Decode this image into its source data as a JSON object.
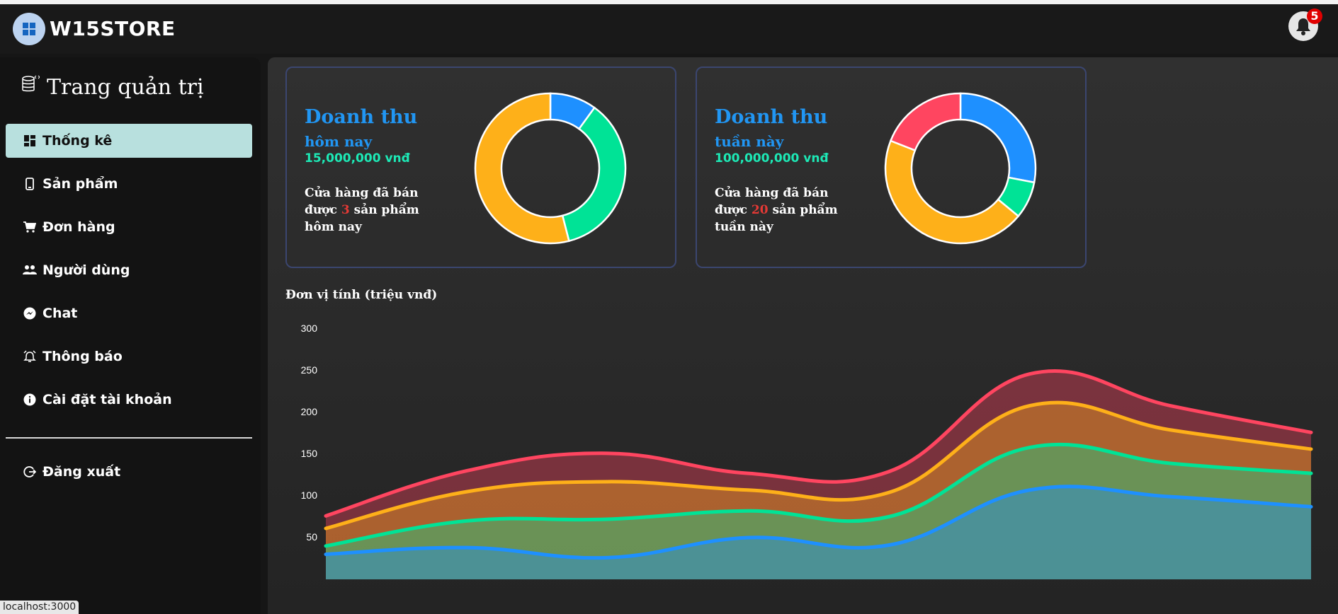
{
  "app": {
    "brand": "W15STORE",
    "notification_count": "5"
  },
  "sidebar": {
    "title": "Trang quản trị",
    "items": [
      {
        "label": "Thống kê",
        "icon": "dashboard-icon",
        "active": true
      },
      {
        "label": "Sản phẩm",
        "icon": "phone-icon"
      },
      {
        "label": "Đơn hàng",
        "icon": "cart-icon"
      },
      {
        "label": "Người dùng",
        "icon": "users-icon"
      },
      {
        "label": "Chat",
        "icon": "messenger-icon"
      },
      {
        "label": "Thông báo",
        "icon": "alarm-icon"
      },
      {
        "label": "Cài đặt tài khoản",
        "icon": "info-icon"
      }
    ],
    "logout": "Đăng xuất"
  },
  "cards": [
    {
      "title": "Doanh thu",
      "subtitle": "hôm nay",
      "amount": "15,000,000 vnđ",
      "desc_pre": "Cửa hàng đã bán được ",
      "count": "3",
      "desc_post": " sản phẩm hôm nay"
    },
    {
      "title": "Doanh thu",
      "subtitle": "tuần này",
      "amount": "100,000,000 vnđ",
      "desc_pre": "Cửa hàng đã bán được ",
      "count": "20",
      "desc_post": " sản phẩm tuần này"
    }
  ],
  "status_url": "localhost:3000",
  "colors": {
    "blue": "#2196f3",
    "green": "#00e396",
    "orange": "#feb019",
    "red": "#ff4560"
  },
  "chart_data": [
    {
      "type": "pie",
      "variant": "donut",
      "slices": [
        {
          "value": 10,
          "color": "#1e90ff"
        },
        {
          "value": 36,
          "color": "#00e396"
        },
        {
          "value": 54,
          "color": "#feb019"
        }
      ]
    },
    {
      "type": "pie",
      "variant": "donut",
      "slices": [
        {
          "value": 28,
          "color": "#1e90ff"
        },
        {
          "value": 8,
          "color": "#00e396"
        },
        {
          "value": 45,
          "color": "#feb019"
        },
        {
          "value": 19,
          "color": "#ff4560"
        }
      ]
    },
    {
      "type": "area",
      "stacked": true,
      "ylabel": "Đơn vị tính (triệu vnđ)",
      "yticks": [
        50,
        100,
        150,
        200,
        250,
        300
      ],
      "ylim": [
        0,
        300
      ],
      "x": [
        0,
        1,
        2,
        3,
        4,
        5,
        6,
        7
      ],
      "series": [
        {
          "color": "#1e90ff",
          "values": [
            30,
            38,
            26,
            50,
            41,
            107,
            99,
            87
          ]
        },
        {
          "color": "#00e396",
          "values": [
            10,
            32,
            46,
            32,
            34,
            51,
            40,
            40
          ]
        },
        {
          "color": "#feb019",
          "values": [
            21,
            35,
            45,
            25,
            29,
            50,
            40,
            29
          ]
        },
        {
          "color": "#ff4560",
          "values": [
            15,
            25,
            34,
            20,
            25,
            38,
            29,
            20
          ]
        }
      ]
    }
  ]
}
